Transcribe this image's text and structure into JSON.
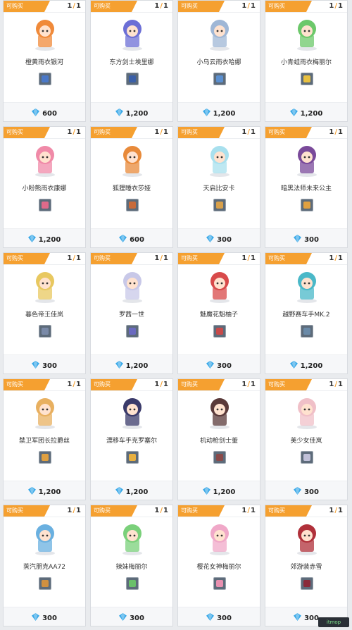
{
  "tag_label": "可购买",
  "count_current": "1",
  "count_total": "1",
  "items": [
    {
      "name": "橙黄雨衣银河",
      "price": "600",
      "color": "#f08a3a",
      "thumb": "#4a78c8"
    },
    {
      "name": "东方剑士埃里娜",
      "price": "1,200",
      "color": "#6c6fd6",
      "thumb": "#3a5fa8"
    },
    {
      "name": "小乌云雨衣哈娜",
      "price": "1,200",
      "color": "#9fb7d6",
      "thumb": "#5a8fd0"
    },
    {
      "name": "小青蛙雨衣梅丽尔",
      "price": "1,200",
      "color": "#6cc86a",
      "thumb": "#e8c040"
    },
    {
      "name": "小粉熊雨衣康娜",
      "price": "1,200",
      "color": "#f08aa8",
      "thumb": "#e06a8a"
    },
    {
      "name": "狐狸睡衣莎娅",
      "price": "600",
      "color": "#e88a3a",
      "thumb": "#c86a3a"
    },
    {
      "name": "天启比安卡",
      "price": "300",
      "color": "#a8e0ee",
      "thumb": "#d8a04a"
    },
    {
      "name": "暗黑法师未来公主",
      "price": "300",
      "color": "#7a4a9a",
      "thumb": "#e0a040"
    },
    {
      "name": "暮色帝王佳岚",
      "price": "300",
      "color": "#e8c860",
      "thumb": "#7a8aa8"
    },
    {
      "name": "罗茜一世",
      "price": "1,200",
      "color": "#c8c8e8",
      "thumb": "#6a6ac0"
    },
    {
      "name": "魅魔花魁柚子",
      "price": "300",
      "color": "#d84a4a",
      "thumb": "#c84a4a"
    },
    {
      "name": "越野赛车手MK.2",
      "price": "1,200",
      "color": "#4ab8c8",
      "thumb": "#6a8aa8"
    },
    {
      "name": "禁卫军团长拉爵丝",
      "price": "1,200",
      "color": "#e8b060",
      "thumb": "#e0a040"
    },
    {
      "name": "漂移车手克罗塞尔",
      "price": "1,200",
      "color": "#3a3a6a",
      "thumb": "#e8b040"
    },
    {
      "name": "机动枪剑士董",
      "price": "1,200",
      "color": "#5a3a3a",
      "thumb": "#8a4a4a"
    },
    {
      "name": "美少女佳岚",
      "price": "300",
      "color": "#f0c0c8",
      "thumb": "#c0c0d8"
    },
    {
      "name": "蒸汽朋克AA72",
      "price": "300",
      "color": "#6ab0e0",
      "thumb": "#d09040"
    },
    {
      "name": "辣妹梅丽尔",
      "price": "300",
      "color": "#7ad07a",
      "thumb": "#6ac06a"
    },
    {
      "name": "樱花女神梅丽尔",
      "price": "300",
      "color": "#f0a8c8",
      "thumb": "#e890b0"
    },
    {
      "name": "郊游装赤雪",
      "price": "300",
      "color": "#b0303a",
      "thumb": "#8a2a3a"
    }
  ],
  "gem_color": "#38a8e8",
  "accent_color": "#f5a030",
  "watermark": "itmop"
}
